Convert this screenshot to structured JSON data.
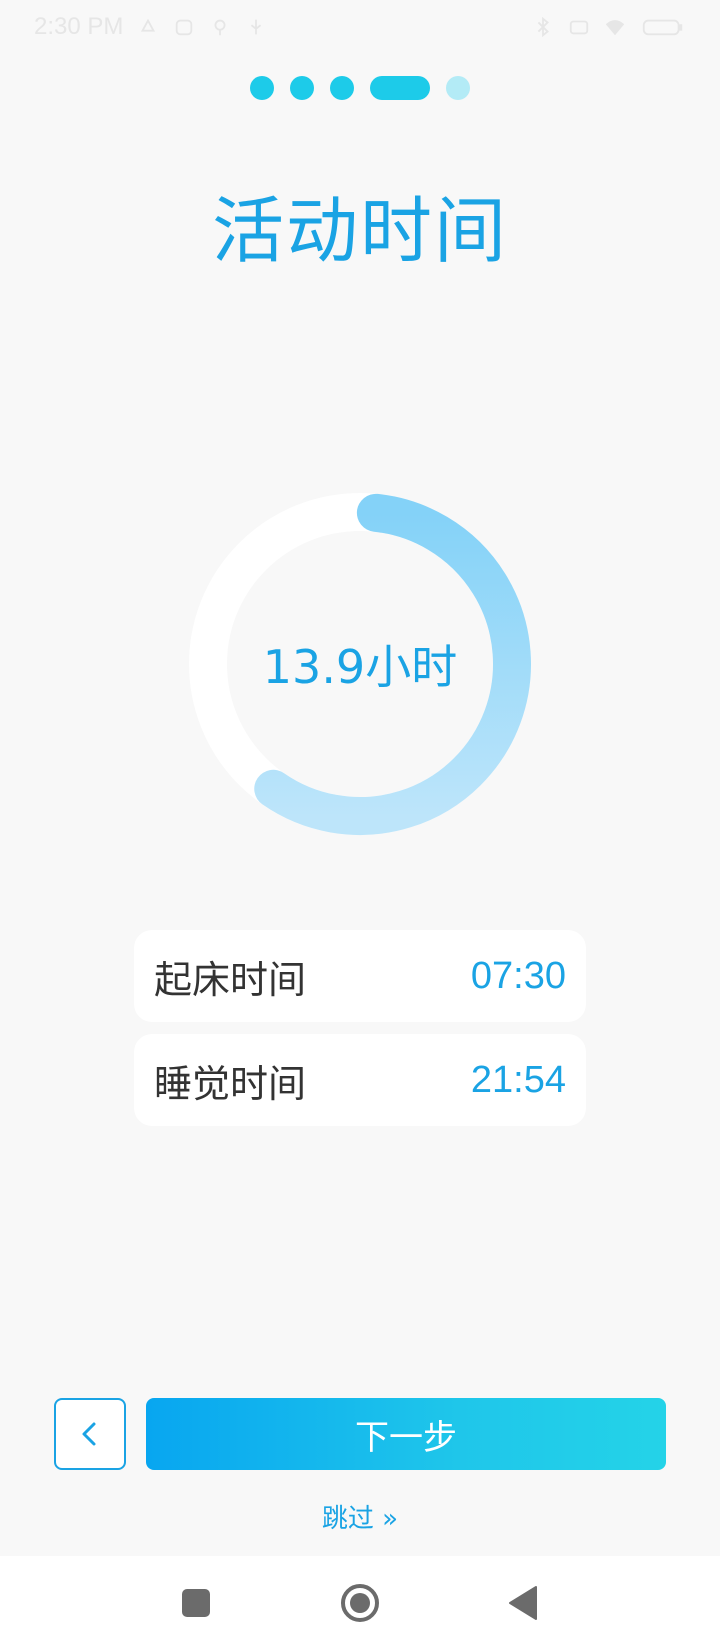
{
  "status_bar": {
    "time": "2:30 PM",
    "left_icons": [
      "recycle-icon",
      "alarm-icon",
      "location-icon",
      "usb-icon"
    ],
    "right_icons": [
      "bluetooth-icon",
      "sim-icon",
      "wifi-icon",
      "battery-icon"
    ]
  },
  "progress": {
    "total_steps": 5,
    "current_step": 4,
    "active_color": "#1dcbe9",
    "pending_color": "#b3ebf6"
  },
  "title": "活动时间",
  "activity": {
    "duration_label": "13.9小时",
    "ring_fill_fraction": 0.58,
    "ring_colors": [
      "#84d2f8",
      "#bde5fa"
    ]
  },
  "times": {
    "wake": {
      "label": "起床时间",
      "value": "07:30"
    },
    "sleep": {
      "label": "睡觉时间",
      "value": "21:54"
    }
  },
  "buttons": {
    "back_icon": "chevron-left-icon",
    "next_label": "下一步",
    "skip_label": "跳过 »"
  },
  "nav": {
    "icons": [
      "recent-apps-icon",
      "home-icon",
      "back-icon"
    ]
  },
  "colors": {
    "accent": "#1aa3e4",
    "background": "#f8f8f8"
  }
}
